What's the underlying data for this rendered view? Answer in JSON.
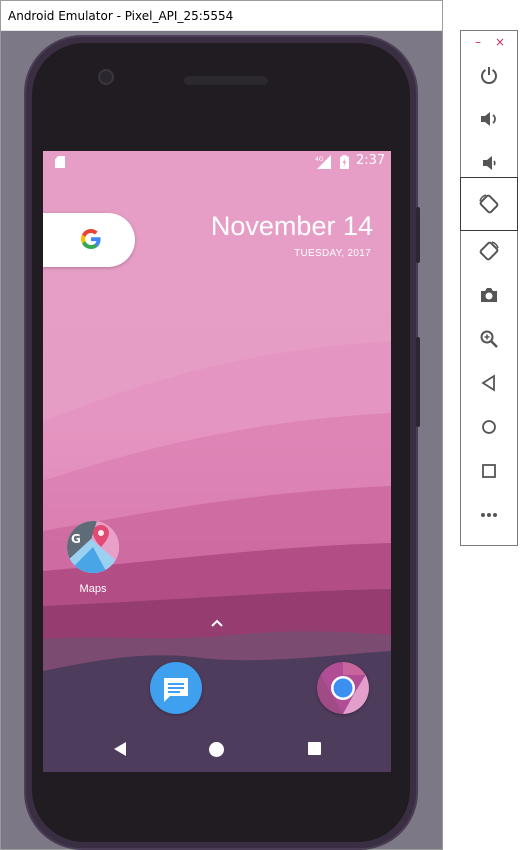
{
  "window": {
    "title": "Android Emulator - Pixel_API_25:5554"
  },
  "statusbar": {
    "time": "2:37",
    "network_label": "4G"
  },
  "widget": {
    "date": "November 14",
    "weekday_date": "TUESDAY, 2017"
  },
  "home": {
    "apps": [
      {
        "label": "Maps"
      }
    ],
    "dock": [
      "messages",
      "chrome"
    ]
  },
  "toolbar": {
    "minimize_label": "–",
    "close_label": "×",
    "buttons": [
      "power-icon",
      "volume-up-icon",
      "volume-down-icon",
      "rotate-left-icon",
      "rotate-right-icon",
      "screenshot-icon",
      "zoom-icon",
      "back-icon",
      "home-icon",
      "overview-icon",
      "more-icon"
    ]
  },
  "colors": {
    "accent": "#c7305a",
    "wallpaper_top": "#e79ec6",
    "wallpaper_mid": "#c2588f",
    "wallpaper_bottom": "#4a3a55"
  }
}
